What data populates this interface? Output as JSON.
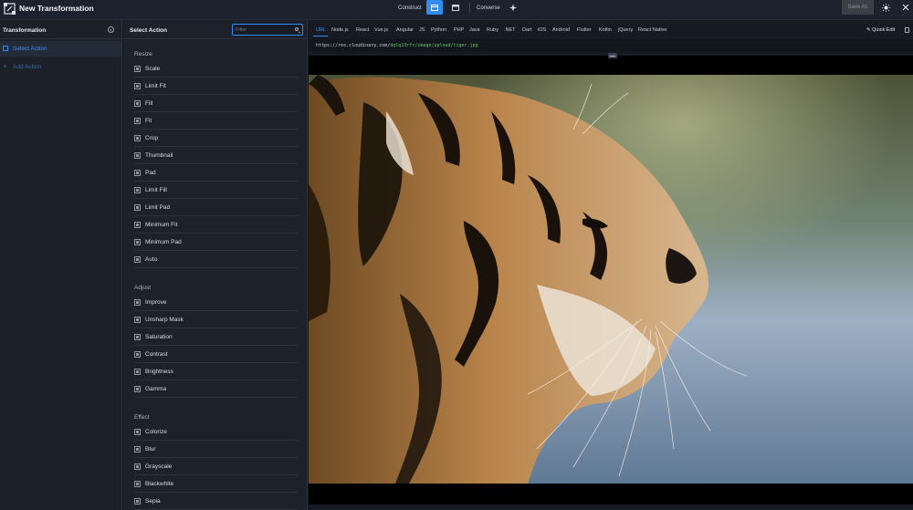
{
  "topbar": {
    "title": "New Transformation",
    "construct_label": "Construct",
    "converse_label": "Converse",
    "save_as_label": "Save As"
  },
  "left_panel": {
    "title": "Transformation",
    "select_action_label": "Select Action",
    "add_action_label": "Add Action"
  },
  "mid_panel": {
    "title": "Select Action",
    "filter_placeholder": "Filter",
    "resize_label": "Resize",
    "resize_items": [
      "Scale",
      "Limit Fit",
      "Fill",
      "Fit",
      "Crop",
      "Thumbnail",
      "Pad",
      "Limit Fill",
      "Limit Pad",
      "Minimum Fit",
      "Minimum Pad",
      "Auto"
    ],
    "adjust_label": "Adjust",
    "adjust_items": [
      "Improve",
      "Unsharp Mask",
      "Saturation",
      "Contrast",
      "Brightness",
      "Gamma"
    ],
    "effect_label": "Effect",
    "effect_items": [
      "Colorize",
      "Blur",
      "Grayscale",
      "Blackwhite",
      "Sepia"
    ]
  },
  "right_panel": {
    "tabs": [
      "URL",
      "Node.js",
      "React",
      "Vue.js",
      "Angular",
      "JS",
      "Python",
      "PHP",
      "Java",
      "Ruby",
      ".NET",
      "Dart",
      "iOS",
      "Android",
      "Flutter",
      "Kotlin",
      "jQuery",
      "React Native"
    ],
    "active_tab": "URL",
    "quick_edit_label": "Quick Edit",
    "url_base": "https://res.cloudinary.com/",
    "url_path": "dqlq13rfr/image/upload/tiger.jpg"
  },
  "colors": {
    "accent": "#2f8cf0",
    "background": "#141821",
    "panel": "#1b2029"
  },
  "icons": [
    "tools-logo-icon",
    "info-icon",
    "construct-view-icon",
    "converse-view-icon",
    "sparkle-icon",
    "sun-icon",
    "close-icon",
    "filter-search-icon",
    "copy-icon",
    "pencil-icon"
  ]
}
